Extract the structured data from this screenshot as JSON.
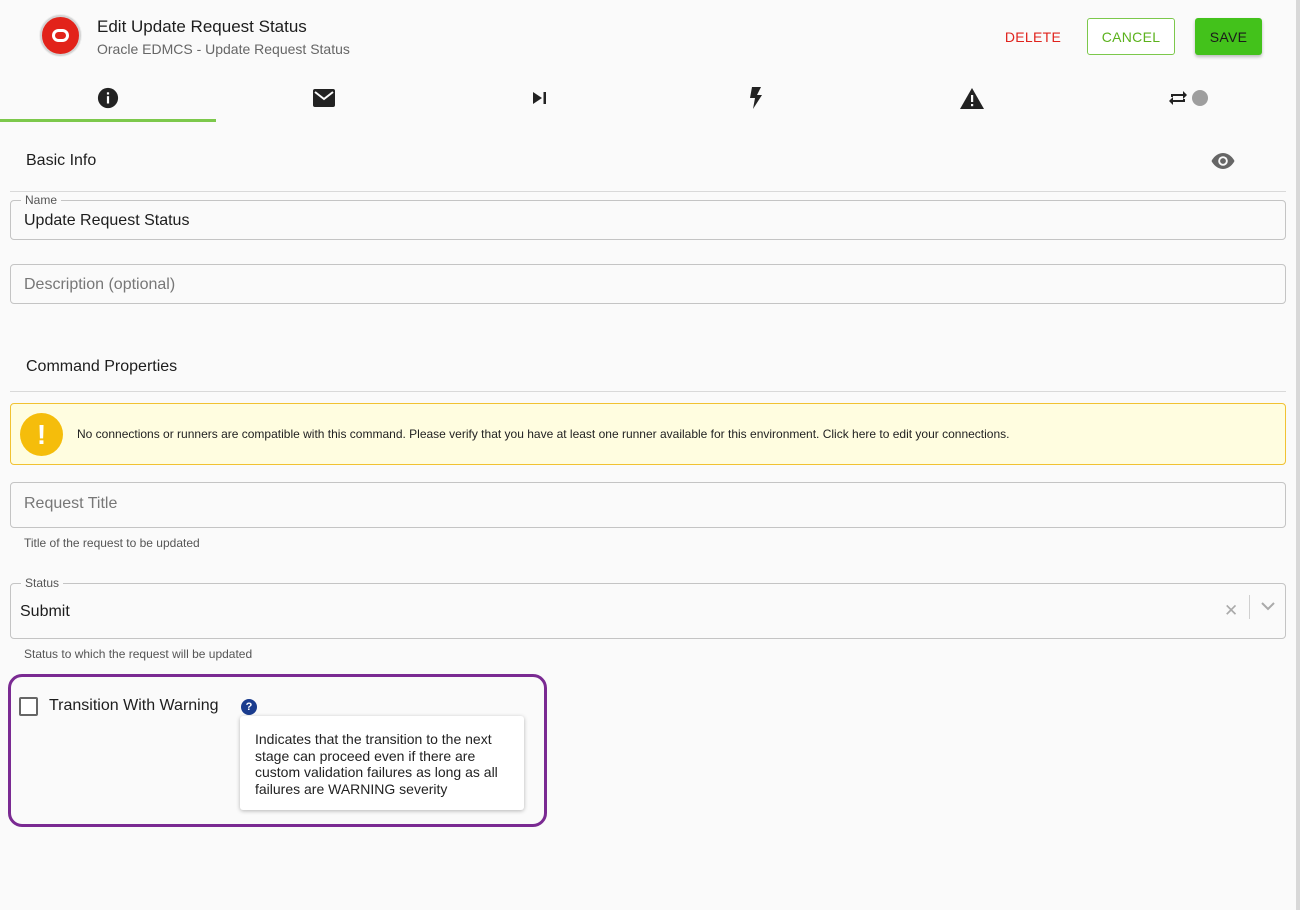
{
  "header": {
    "title": "Edit Update Request Status",
    "subtitle": "Oracle EDMCS - Update Request Status",
    "delete_label": "DELETE",
    "cancel_label": "CANCEL",
    "save_label": "SAVE"
  },
  "tabs": [
    {
      "icon": "info-icon",
      "active": true
    },
    {
      "icon": "mail-icon",
      "active": false
    },
    {
      "icon": "skip-next-icon",
      "active": false
    },
    {
      "icon": "flash-icon",
      "active": false
    },
    {
      "icon": "warning-icon",
      "active": false
    },
    {
      "icon": "repeat-icon",
      "active": false
    }
  ],
  "basic_info": {
    "title": "Basic Info",
    "name_legend": "Name",
    "name_value": "Update Request Status",
    "description_placeholder": "Description (optional)"
  },
  "command_properties": {
    "title": "Command Properties",
    "warning_text": "No connections or runners are compatible with this command. Please verify that you have at least one runner available for this environment. Click here to edit your connections.",
    "request_title_placeholder": "Request Title",
    "request_title_helper": "Title of the request to be updated",
    "status_legend": "Status",
    "status_value": "Submit",
    "status_helper": "Status to which the request will be updated",
    "transition_label": "Transition With Warning",
    "transition_checked": false,
    "help_glyph": "?",
    "tooltip_text": "Indicates that the transition to the next stage can proceed even if there are custom validation failures as long as all failures are WARNING severity"
  },
  "colors": {
    "accent_green": "#43c21b",
    "delete_red": "#e0231d",
    "warning_yellow": "#f5bd0b",
    "highlight_purple": "#7a2a92",
    "brand_red": "#e2231a"
  }
}
